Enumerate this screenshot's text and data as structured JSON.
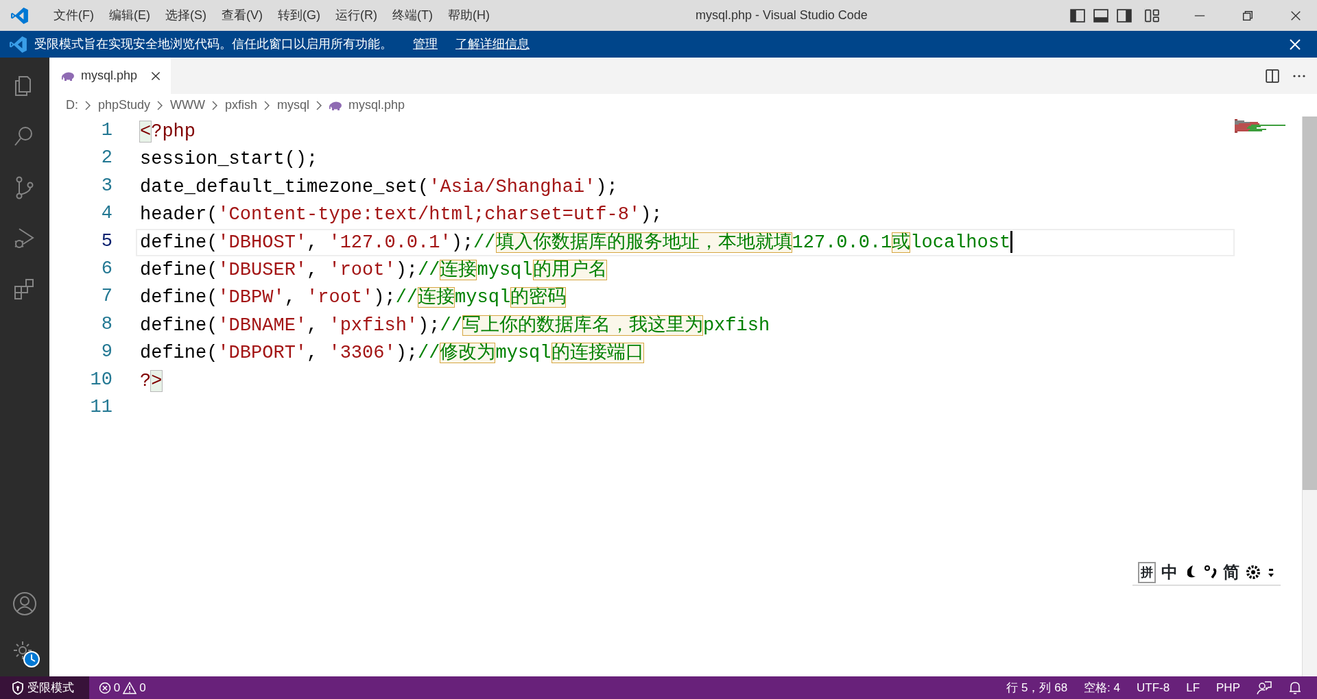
{
  "title_bar": {
    "menu": [
      "文件(F)",
      "编辑(E)",
      "选择(S)",
      "查看(V)",
      "转到(G)",
      "运行(R)",
      "终端(T)",
      "帮助(H)"
    ],
    "title": "mysql.php - Visual Studio Code"
  },
  "banner": {
    "message": "受限模式旨在实现安全地浏览代码。信任此窗口以启用所有功能。",
    "links": [
      "管理",
      "了解详细信息"
    ]
  },
  "tabs": [
    {
      "label": "mysql.php",
      "selected": true
    }
  ],
  "breadcrumb": [
    {
      "label": "D:",
      "kind": "folder"
    },
    {
      "label": "phpStudy",
      "kind": "folder"
    },
    {
      "label": "WWW",
      "kind": "folder"
    },
    {
      "label": "pxfish",
      "kind": "folder"
    },
    {
      "label": "mysql",
      "kind": "folder"
    },
    {
      "label": "mysql.php",
      "kind": "file"
    }
  ],
  "editor": {
    "lines": [
      {
        "number": "1",
        "current": false,
        "tokens": [
          {
            "kind": "bracket",
            "text": "<"
          },
          {
            "kind": "tag",
            "text": "?php"
          }
        ]
      },
      {
        "number": "2",
        "current": false,
        "tokens": [
          {
            "kind": "plain",
            "text": "session_start();"
          }
        ]
      },
      {
        "number": "3",
        "current": false,
        "tokens": [
          {
            "kind": "plain",
            "text": "date_default_timezone_set("
          },
          {
            "kind": "string",
            "text": "'Asia/Shanghai'"
          },
          {
            "kind": "plain",
            "text": ");"
          }
        ]
      },
      {
        "number": "4",
        "current": false,
        "tokens": [
          {
            "kind": "plain",
            "text": "header("
          },
          {
            "kind": "string",
            "text": "'Content-type:text/html;charset=utf-8'"
          },
          {
            "kind": "plain",
            "text": ");"
          }
        ]
      },
      {
        "number": "5",
        "current": true,
        "tokens": [
          {
            "kind": "plain",
            "text": "define("
          },
          {
            "kind": "string",
            "text": "'DBHOST'"
          },
          {
            "kind": "plain",
            "text": ", "
          },
          {
            "kind": "string",
            "text": "'127.0.0.1'"
          },
          {
            "kind": "plain",
            "text": ");"
          },
          {
            "kind": "comment",
            "text": "//"
          },
          {
            "kind": "unicode",
            "text": "填入你数据库的服务地址，本地就填"
          },
          {
            "kind": "comment",
            "text": "127.0.0.1"
          },
          {
            "kind": "unicode",
            "text": "或"
          },
          {
            "kind": "comment",
            "text": "localhost"
          }
        ]
      },
      {
        "number": "6",
        "current": false,
        "tokens": [
          {
            "kind": "plain",
            "text": "define("
          },
          {
            "kind": "string",
            "text": "'DBUSER'"
          },
          {
            "kind": "plain",
            "text": ", "
          },
          {
            "kind": "string",
            "text": "'root'"
          },
          {
            "kind": "plain",
            "text": ");"
          },
          {
            "kind": "comment",
            "text": "//"
          },
          {
            "kind": "unicode",
            "text": "连接"
          },
          {
            "kind": "comment",
            "text": "mysql"
          },
          {
            "kind": "unicode",
            "text": "的用户名"
          }
        ]
      },
      {
        "number": "7",
        "current": false,
        "tokens": [
          {
            "kind": "plain",
            "text": "define("
          },
          {
            "kind": "string",
            "text": "'DBPW'"
          },
          {
            "kind": "plain",
            "text": ", "
          },
          {
            "kind": "string",
            "text": "'root'"
          },
          {
            "kind": "plain",
            "text": ");"
          },
          {
            "kind": "comment",
            "text": "//"
          },
          {
            "kind": "unicode",
            "text": "连接"
          },
          {
            "kind": "comment",
            "text": "mysql"
          },
          {
            "kind": "unicode",
            "text": "的密码"
          }
        ]
      },
      {
        "number": "8",
        "current": false,
        "tokens": [
          {
            "kind": "plain",
            "text": "define("
          },
          {
            "kind": "string",
            "text": "'DBNAME'"
          },
          {
            "kind": "plain",
            "text": ", "
          },
          {
            "kind": "string",
            "text": "'pxfish'"
          },
          {
            "kind": "plain",
            "text": ");"
          },
          {
            "kind": "comment",
            "text": "//"
          },
          {
            "kind": "unicode",
            "text": "写上你的数据库名，我这里为"
          },
          {
            "kind": "comment",
            "text": "pxfish"
          }
        ]
      },
      {
        "number": "9",
        "current": false,
        "tokens": [
          {
            "kind": "plain",
            "text": "define("
          },
          {
            "kind": "string",
            "text": "'DBPORT'"
          },
          {
            "kind": "plain",
            "text": ", "
          },
          {
            "kind": "string",
            "text": "'3306'"
          },
          {
            "kind": "plain",
            "text": ");"
          },
          {
            "kind": "comment",
            "text": "//"
          },
          {
            "kind": "unicode",
            "text": "修改为"
          },
          {
            "kind": "comment",
            "text": "mysql"
          },
          {
            "kind": "unicode",
            "text": "的连接端口"
          }
        ]
      },
      {
        "number": "10",
        "current": false,
        "tokens": [
          {
            "kind": "tag",
            "text": "?"
          },
          {
            "kind": "bracket",
            "text": ">"
          }
        ]
      },
      {
        "number": "11",
        "current": false
      }
    ]
  },
  "ime_toolbar": {
    "mode": "拼",
    "language": "中",
    "charset": "简"
  },
  "status_bar": {
    "restricted": "受限模式",
    "errors": "0",
    "warnings": "0",
    "position": "行 5，列 68",
    "indent": "空格: 4",
    "encoding": "UTF-8",
    "eol": "LF",
    "language": "PHP"
  }
}
